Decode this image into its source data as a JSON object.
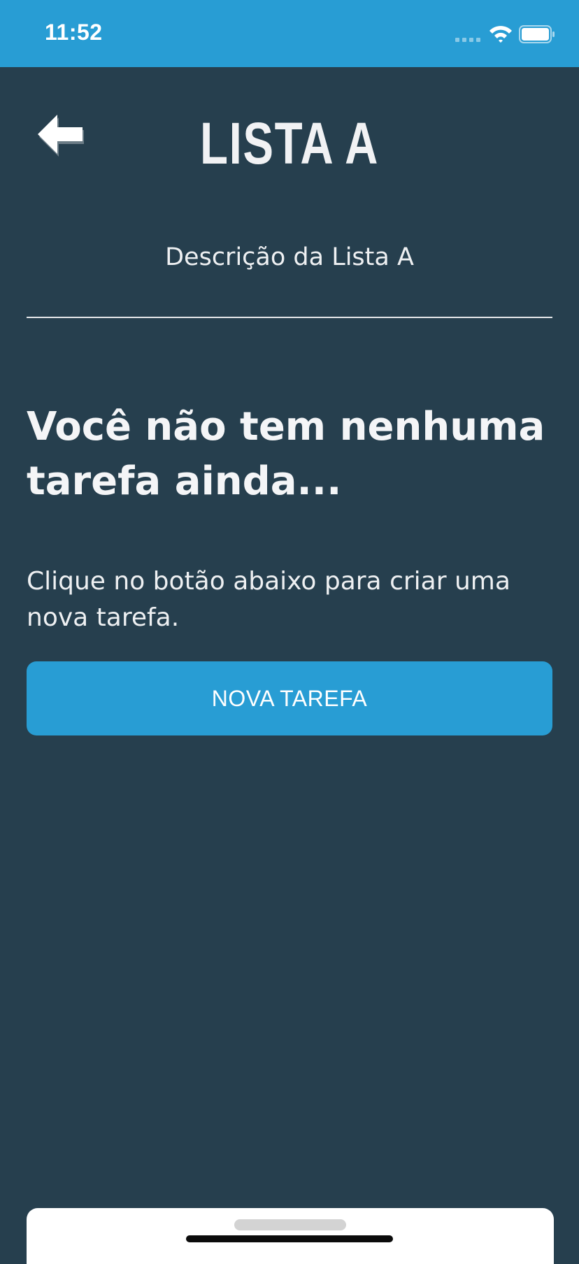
{
  "status_bar": {
    "time": "11:52",
    "wifi_icon": "wifi-icon",
    "battery_icon": "battery-icon",
    "background_color": "#289dd4"
  },
  "header": {
    "back_icon": "arrow-left-icon",
    "title": "LISTA A",
    "description": "Descrição da Lista A"
  },
  "empty_state": {
    "heading": "Você não tem nenhuma tarefa ainda...",
    "message": "Clique no botão abaixo para criar uma nova tarefa.",
    "button_label": "NOVA TAREFA"
  },
  "colors": {
    "background": "#263f4e",
    "accent": "#289dd4",
    "text": "#f3f4f6"
  }
}
